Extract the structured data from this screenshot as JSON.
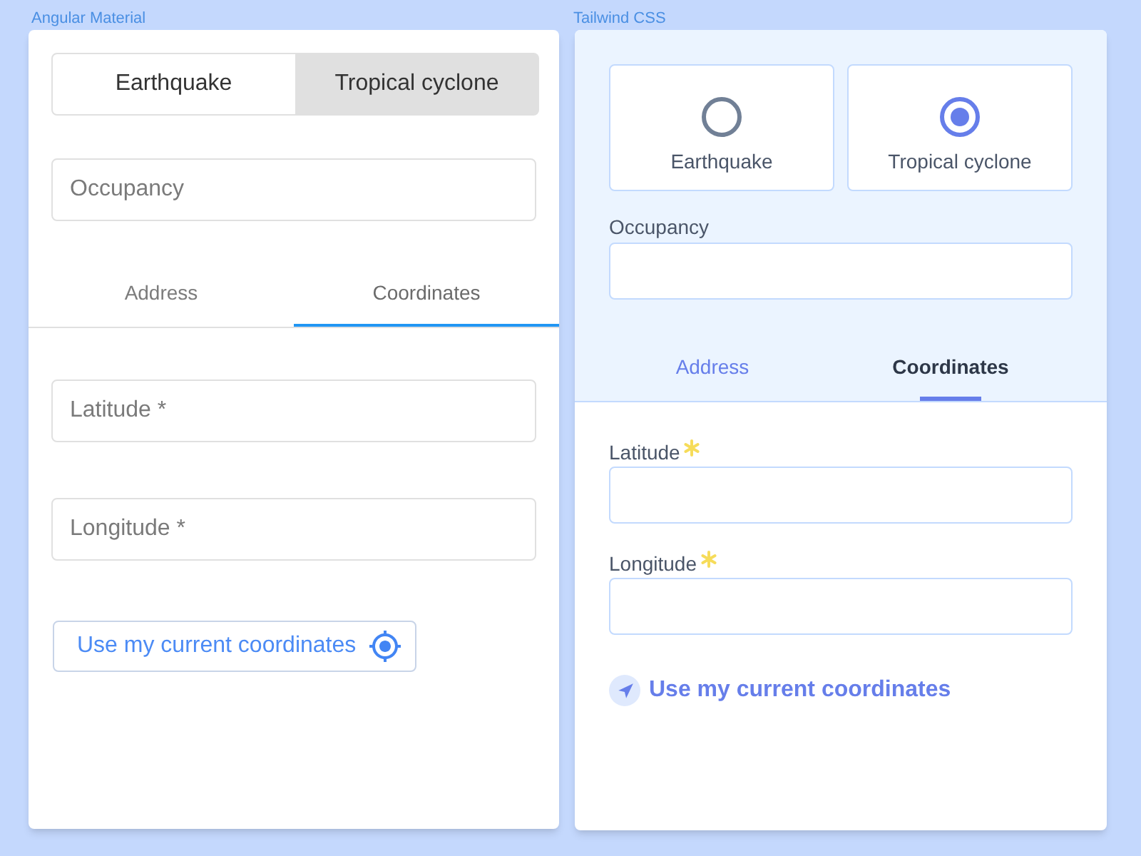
{
  "panels": [
    {
      "kind": "material",
      "caption": "Angular Material",
      "hazard_options": [
        {
          "label": "Earthquake",
          "selected": false
        },
        {
          "label": "Tropical cyclone",
          "selected": true
        }
      ],
      "occupancy": {
        "placeholder": "Occupancy"
      },
      "tabs": [
        {
          "label": "Address",
          "selected": false
        },
        {
          "label": "Coordinates",
          "selected": true
        }
      ],
      "fields": [
        {
          "placeholder": "Latitude *"
        },
        {
          "placeholder": "Longitude *"
        }
      ],
      "locate_button": "Use my current coordinates"
    },
    {
      "kind": "tailwind",
      "caption": "Tailwind CSS",
      "hazard_options": [
        {
          "label": "Earthquake",
          "selected": false
        },
        {
          "label": "Tropical cyclone",
          "selected": true
        }
      ],
      "occupancy": {
        "label": "Occupancy"
      },
      "tabs": [
        {
          "label": "Address",
          "selected": false
        },
        {
          "label": "Coordinates",
          "selected": true
        }
      ],
      "fields": [
        {
          "label": "Latitude",
          "required": true
        },
        {
          "label": "Longitude",
          "required": true
        }
      ],
      "locate_button": "Use my current coordinates"
    }
  ]
}
